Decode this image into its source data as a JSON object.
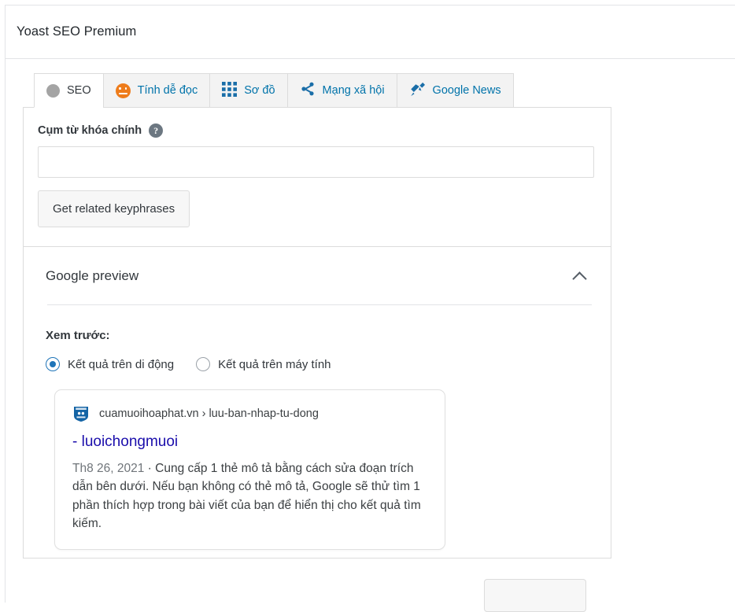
{
  "metabox": {
    "title": "Yoast SEO Premium"
  },
  "tabs": [
    {
      "id": "seo",
      "label": "SEO",
      "icon": "grey-circle-icon",
      "active": true
    },
    {
      "id": "readability",
      "label": "Tính dễ đọc",
      "icon": "orange-face-icon",
      "active": false
    },
    {
      "id": "schema",
      "label": "Sơ đồ",
      "icon": "grid-icon",
      "active": false
    },
    {
      "id": "social",
      "label": "Mạng xã hội",
      "icon": "share-icon",
      "active": false
    },
    {
      "id": "news",
      "label": "Google News",
      "icon": "megaphone-icon",
      "active": false
    }
  ],
  "keyphrase": {
    "label": "Cụm từ khóa chính",
    "help_icon": "help-circle-icon",
    "value": "",
    "placeholder": "",
    "button_label": "Get related keyphrases"
  },
  "google_preview": {
    "title": "Google preview",
    "collapse_icon": "chevron-up-icon",
    "preview_mode_label": "Xem trước:",
    "radios": [
      {
        "id": "mobile",
        "label": "Kết quả trên di động",
        "checked": true
      },
      {
        "id": "desktop",
        "label": "Kết quả trên máy tính",
        "checked": false
      }
    ],
    "serp": {
      "favicon": "site-shield-favicon",
      "url": "cuamuoihoaphat.vn › luu-ban-nhap-tu-dong",
      "title": "- luoichongmuoi",
      "date": "Th8 26, 2021",
      "separator": "·",
      "description": "Cung cấp 1 thẻ mô tả bằng cách sửa đoạn trích dẫn bên dưới. Nếu bạn không có thẻ mô tả, Google sẽ thử tìm 1 phần thích hợp trong bài viết của bạn để hiển thị cho kết quả tìm kiếm."
    }
  },
  "bottom_button": {
    "label": ""
  },
  "colors": {
    "link_blue": "#0073aa",
    "serp_title_blue": "#1a0dab",
    "accent_orange": "#ee7c1b",
    "icon_blue": "#1a6ea8",
    "radio_blue": "#1e74b8",
    "border_grey": "#dcdcdc"
  }
}
